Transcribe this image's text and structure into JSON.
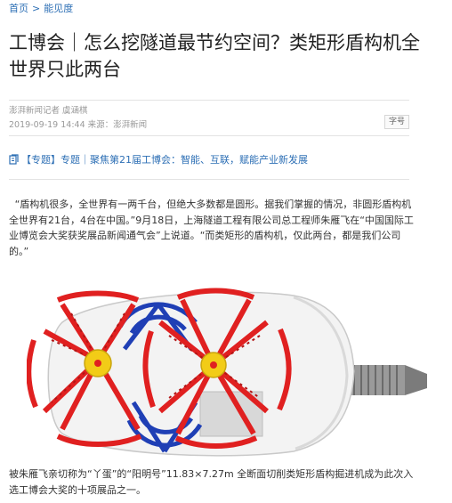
{
  "breadcrumb": {
    "home": "首页",
    "separator": ">",
    "section": "能见度"
  },
  "article": {
    "title": "工博会｜怎么挖隧道最节约空间？类矩形盾构机全世界只此两台",
    "author": "澎湃新闻记者 虞涵棋",
    "date_source": "2019-09-19 14:44 来源：澎湃新闻",
    "font_size_button": "字号",
    "topic_prefix": "【专题】",
    "topic_link": "专题｜聚焦第21届工博会：智能、互联，赋能产业新发展",
    "paragraph": "“盾构机很多，全世界有一两千台，但绝大多数都是圆形。据我们掌握的情况，非圆形盾构机全世界有21台，4台在中国。”9月18日，上海隧道工程有限公司总工程师朱雁飞在“中国国际工业博览会大奖获奖展品新闻通气会”上说道。“而类矩形的盾构机，仅此两台，都是我们公司的。”",
    "caption": "被朱雁飞亲切称为“丫蛋”的“阳明号”11.83×7.27m 全断面切削类矩形盾构掘进机成为此次入选工博会大奖的十项展品之一。"
  },
  "icons": {
    "topic": "topic-icon"
  },
  "colors": {
    "link": "#2d6fb5",
    "cutter_red": "#e02020",
    "cutter_blue": "#1f3fb5",
    "hub_yellow": "#f2cc17"
  }
}
